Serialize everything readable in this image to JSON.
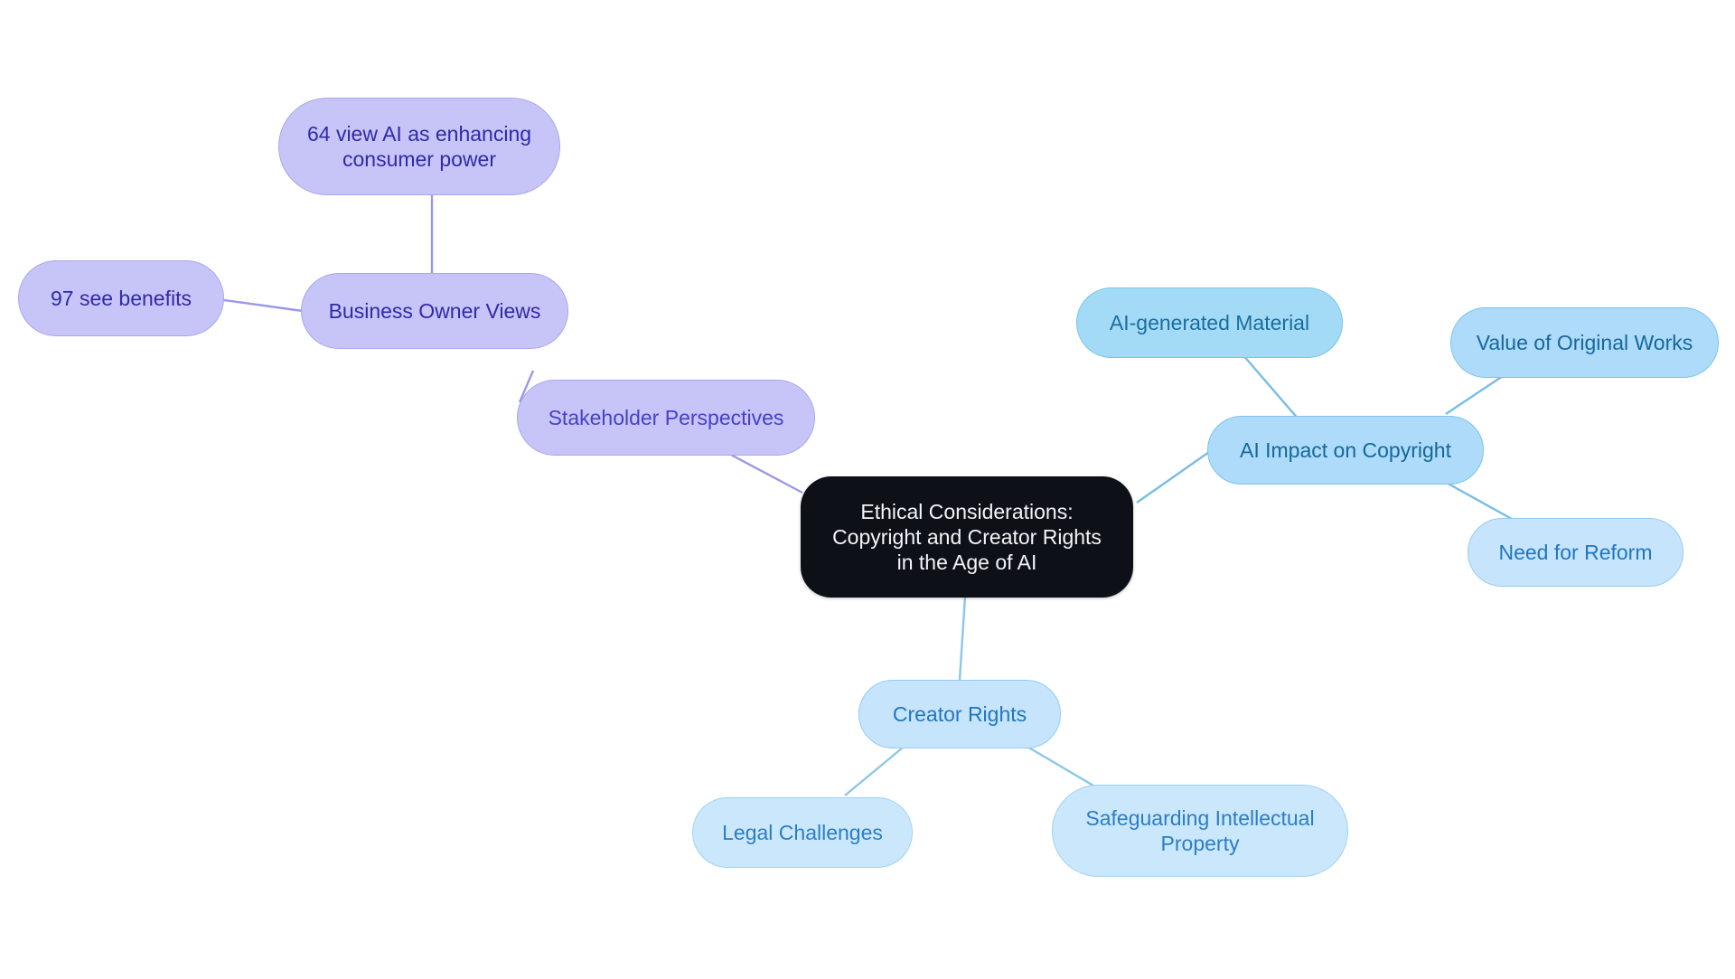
{
  "diagram": {
    "type": "mindmap",
    "title": "Ethical Considerations: Copyright and Creator Rights in the Age of AI",
    "background_color": "#ffffff",
    "root": {
      "id": "root",
      "label": "Ethical Considerations:\nCopyright and Creator Rights\nin the Age of AI",
      "fill": "#0d1117",
      "text_color": "#f2f4f7"
    },
    "nodes": [
      {
        "id": "stakeholder-perspectives",
        "label": "Stakeholder Perspectives",
        "fill": "#c7c5f7",
        "text_color": "#4641c9",
        "branch": "purple",
        "level": 1
      },
      {
        "id": "business-owner-views",
        "label": "Business Owner Views",
        "fill": "#c7c5f7",
        "text_color": "#2f2aa8",
        "branch": "purple",
        "level": 2
      },
      {
        "id": "view-ai-enhancing-consumer-power",
        "label": "64 view AI as enhancing\nconsumer power",
        "fill": "#c7c5f7",
        "text_color": "#2f2aa8",
        "branch": "purple",
        "level": 3
      },
      {
        "id": "see-benefits",
        "label": "97 see benefits",
        "fill": "#c7c5f7",
        "text_color": "#2f2aa8",
        "branch": "purple",
        "level": 3
      },
      {
        "id": "ai-impact-on-copyright",
        "label": "AI Impact on Copyright",
        "fill": "#aedbf9",
        "text_color": "#15689c",
        "branch": "blue",
        "level": 1
      },
      {
        "id": "ai-generated-material",
        "label": "AI-generated Material",
        "fill": "#a3dbf7",
        "text_color": "#1b6d9e",
        "branch": "blue",
        "level": 2
      },
      {
        "id": "value-of-original-works",
        "label": "Value of Original Works",
        "fill": "#aedbf9",
        "text_color": "#2077c0",
        "branch": "blue",
        "level": 2
      },
      {
        "id": "need-for-reform",
        "label": "Need for Reform",
        "fill": "#c6e4fb",
        "text_color": "#2b7ec4",
        "branch": "blue",
        "level": 2
      },
      {
        "id": "creator-rights",
        "label": "Creator Rights",
        "fill": "#c6e4fb",
        "text_color": "#2077c0",
        "branch": "blue",
        "level": 1
      },
      {
        "id": "legal-challenges",
        "label": "Legal Challenges",
        "fill": "#cbe7fc",
        "text_color": "#2b7ec4",
        "branch": "blue",
        "level": 2
      },
      {
        "id": "safeguarding-intellectual-property",
        "label": "Safeguarding Intellectual\nProperty",
        "fill": "#cbe7fc",
        "text_color": "#2b7ec4",
        "branch": "blue",
        "level": 2
      }
    ],
    "edges": [
      {
        "from": "root",
        "to": "stakeholder-perspectives",
        "color": "#9b98e8"
      },
      {
        "from": "stakeholder-perspectives",
        "to": "business-owner-views",
        "color": "#9b98e8"
      },
      {
        "from": "business-owner-views",
        "to": "view-ai-enhancing-consumer-power",
        "color": "#9b98e8"
      },
      {
        "from": "business-owner-views",
        "to": "see-benefits",
        "color": "#9b98e8"
      },
      {
        "from": "root",
        "to": "ai-impact-on-copyright",
        "color": "#79bde4"
      },
      {
        "from": "ai-impact-on-copyright",
        "to": "ai-generated-material",
        "color": "#79bde4"
      },
      {
        "from": "ai-impact-on-copyright",
        "to": "value-of-original-works",
        "color": "#79bde4"
      },
      {
        "from": "ai-impact-on-copyright",
        "to": "need-for-reform",
        "color": "#79bde4"
      },
      {
        "from": "root",
        "to": "creator-rights",
        "color": "#8cc6e8"
      },
      {
        "from": "creator-rights",
        "to": "legal-challenges",
        "color": "#8cc6e8"
      },
      {
        "from": "creator-rights",
        "to": "safeguarding-intellectual-property",
        "color": "#8cc6e8"
      }
    ]
  }
}
